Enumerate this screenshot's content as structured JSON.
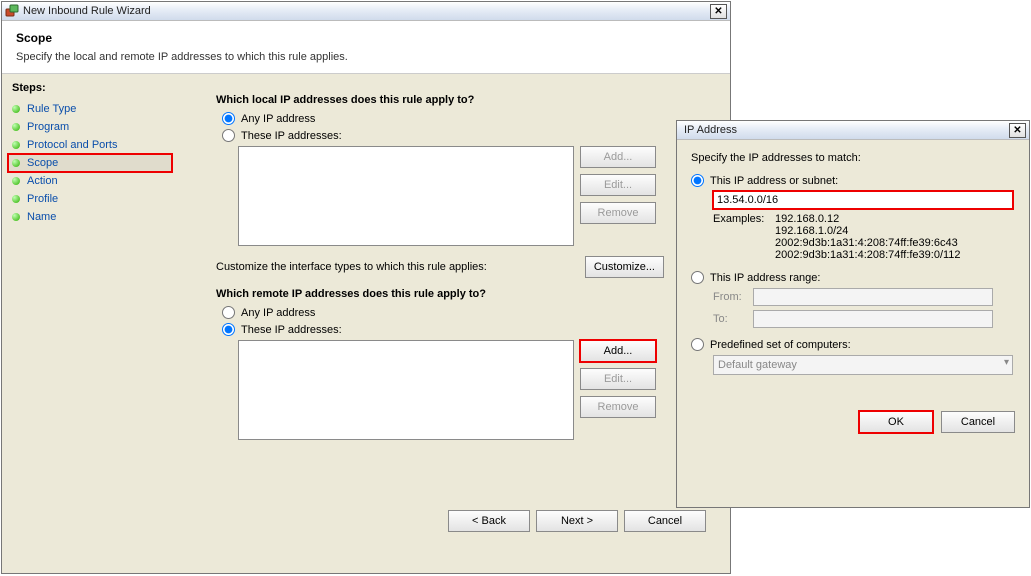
{
  "wizard": {
    "title": "New Inbound Rule Wizard",
    "heading": "Scope",
    "subheading": "Specify the local and remote IP addresses to which this rule applies.",
    "steps_label": "Steps:",
    "steps": [
      {
        "label": "Rule Type"
      },
      {
        "label": "Program"
      },
      {
        "label": "Protocol and Ports"
      },
      {
        "label": "Scope"
      },
      {
        "label": "Action"
      },
      {
        "label": "Profile"
      },
      {
        "label": "Name"
      }
    ],
    "local": {
      "question": "Which local IP addresses does this rule apply to?",
      "any": "Any IP address",
      "these": "These IP addresses:",
      "selected": "any",
      "add": "Add...",
      "edit": "Edit...",
      "remove": "Remove"
    },
    "customize_text": "Customize the interface types to which this rule applies:",
    "customize_btn": "Customize...",
    "remote": {
      "question": "Which remote IP addresses does this rule apply to?",
      "any": "Any IP address",
      "these": "These IP addresses:",
      "selected": "these",
      "add": "Add...",
      "edit": "Edit...",
      "remove": "Remove"
    },
    "nav": {
      "back": "< Back",
      "next": "Next >",
      "cancel": "Cancel"
    }
  },
  "ipdlg": {
    "title": "IP Address",
    "instr": "Specify the IP addresses to match:",
    "opt_subnet": "This IP address or subnet:",
    "subnet_value": "13.54.0.0/16",
    "examples_label": "Examples:",
    "examples": [
      "192.168.0.12",
      "192.168.1.0/24",
      "2002:9d3b:1a31:4:208:74ff:fe39:6c43",
      "2002:9d3b:1a31:4:208:74ff:fe39:0/112"
    ],
    "opt_range": "This IP address range:",
    "from_label": "From:",
    "to_label": "To:",
    "from_value": "",
    "to_value": "",
    "opt_predef": "Predefined set of computers:",
    "predef_value": "Default gateway",
    "selected": "subnet",
    "ok": "OK",
    "cancel": "Cancel"
  }
}
